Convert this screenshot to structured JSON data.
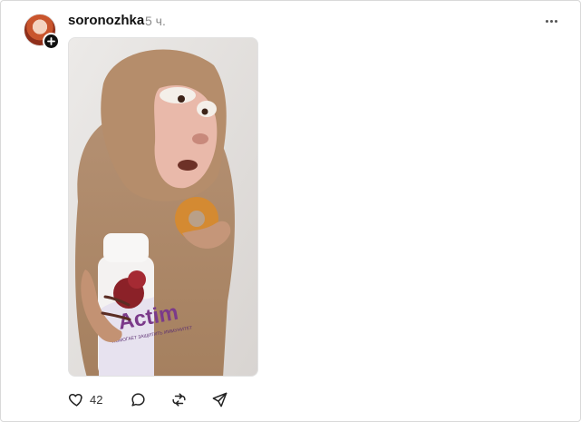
{
  "post": {
    "username": "soronozhka",
    "time": "5 ч.",
    "media": {
      "bottle_text": "Actim",
      "bottle_subtext": "ПОМОГАЕТ ЗАЩИТИТЬ ИММУНИТЕТ"
    },
    "likes_count": "42"
  },
  "icons": {
    "avatar_add": "plus-icon",
    "more": "more-dots-icon",
    "like": "heart-icon",
    "comment": "comment-icon",
    "repost": "repost-icon",
    "share": "share-icon"
  },
  "colors": {
    "text": "#111111",
    "muted": "#8a8a8a",
    "border": "#d9d9d9"
  }
}
